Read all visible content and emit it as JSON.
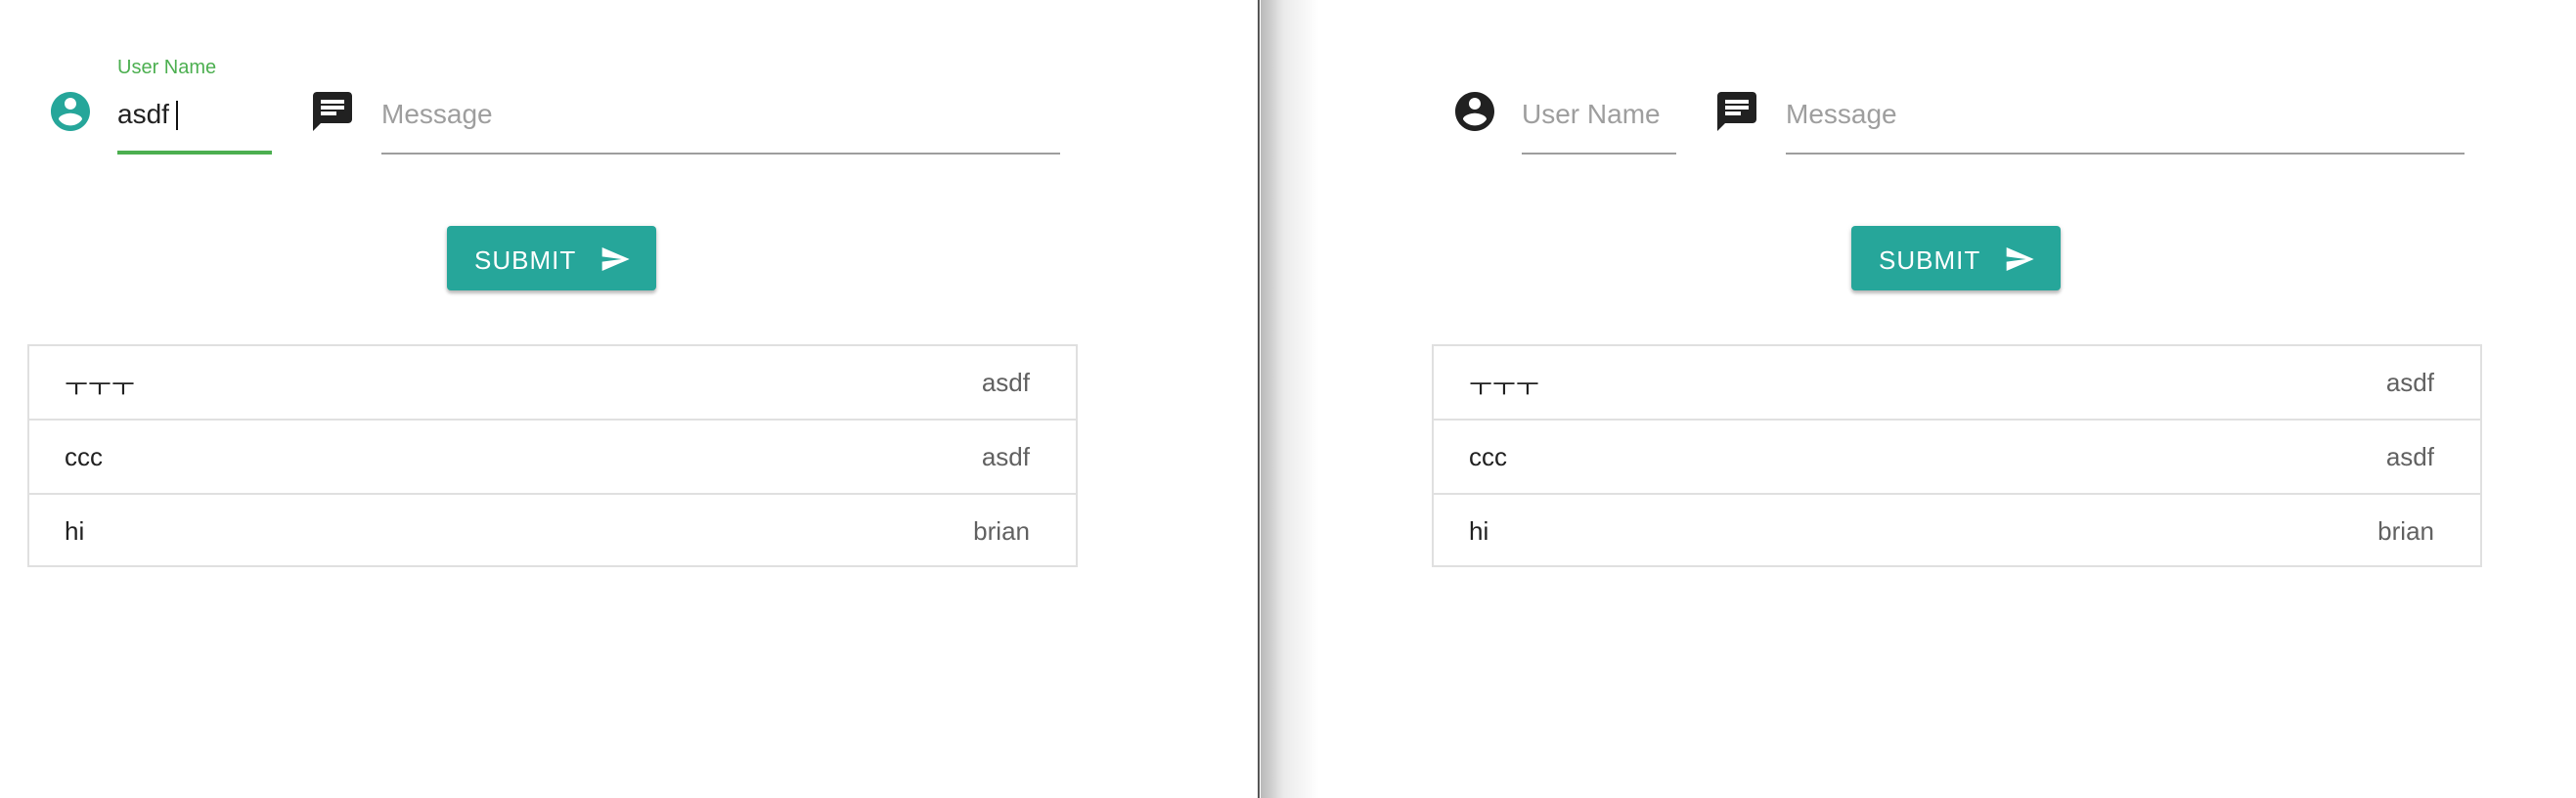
{
  "colors": {
    "accent": "#26a69a",
    "focus_green": "#4caf50",
    "icon_dark": "#212121"
  },
  "panes": [
    {
      "username_field": {
        "label": "User Name",
        "value": "asdf",
        "placeholder": "",
        "focused": true,
        "icon": "account-circle-icon"
      },
      "message_field": {
        "placeholder": "Message",
        "value": "",
        "icon": "chat-bubble-icon"
      },
      "submit_button": {
        "label": "SUBMIT",
        "icon": "send-icon"
      },
      "messages": [
        {
          "text": "ㅜㅜㅜ",
          "user": "asdf"
        },
        {
          "text": "ccc",
          "user": "asdf"
        },
        {
          "text": "hi",
          "user": "brian"
        }
      ]
    },
    {
      "username_field": {
        "label": "User Name",
        "value": "",
        "placeholder": "User Name",
        "focused": false,
        "icon": "account-circle-icon"
      },
      "message_field": {
        "placeholder": "Message",
        "value": "",
        "icon": "chat-bubble-icon"
      },
      "submit_button": {
        "label": "SUBMIT",
        "icon": "send-icon"
      },
      "messages": [
        {
          "text": "ㅜㅜㅜ",
          "user": "asdf"
        },
        {
          "text": "ccc",
          "user": "asdf"
        },
        {
          "text": "hi",
          "user": "brian"
        }
      ]
    }
  ]
}
